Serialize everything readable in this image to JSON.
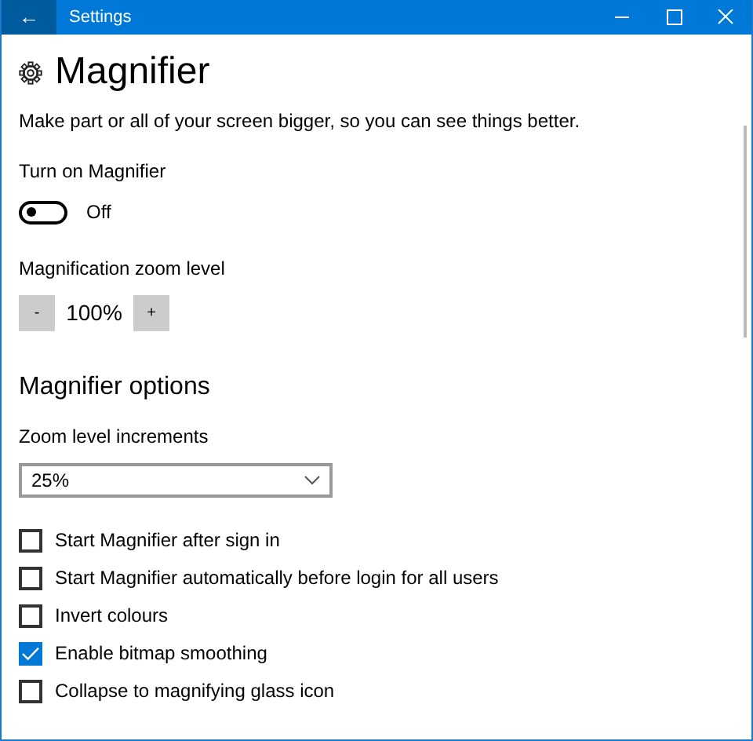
{
  "window": {
    "title": "Settings",
    "back": "←"
  },
  "page": {
    "title": "Magnifier",
    "description": "Make part or all of your screen bigger, so you can see things better."
  },
  "magnifier_toggle": {
    "label": "Turn on Magnifier",
    "on": false,
    "state_text": "Off"
  },
  "zoom_level": {
    "label": "Magnification zoom level",
    "decrease": "-",
    "value": "100%",
    "increase": "+"
  },
  "options_heading": "Magnifier options",
  "increments": {
    "label": "Zoom level increments",
    "value": "25%"
  },
  "options": [
    {
      "label": "Start Magnifier after sign in",
      "checked": false
    },
    {
      "label": "Start Magnifier automatically before login for all users",
      "checked": false
    },
    {
      "label": "Invert colours",
      "checked": false
    },
    {
      "label": "Enable bitmap smoothing",
      "checked": true
    },
    {
      "label": "Collapse to magnifying glass icon",
      "checked": false
    }
  ]
}
